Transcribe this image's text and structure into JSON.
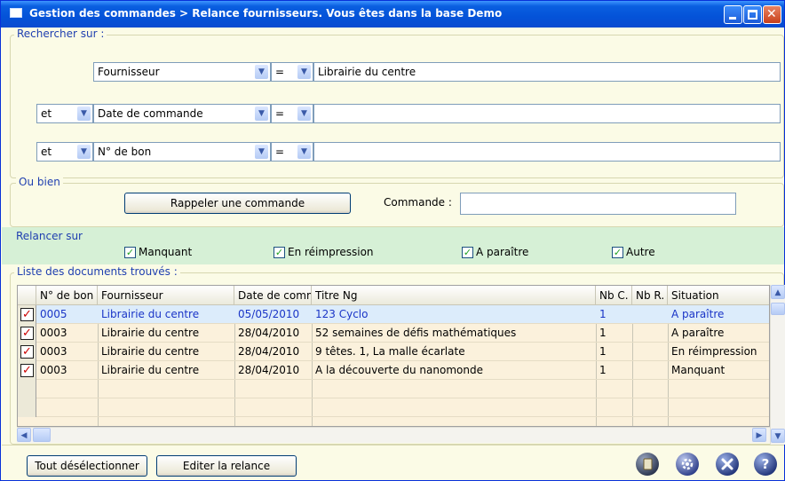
{
  "window": {
    "title": "Gestion des commandes > Relance fournisseurs.  Vous êtes dans la base Demo"
  },
  "search": {
    "legend": "Rechercher sur :",
    "rows": [
      {
        "conj": "",
        "field": "Fournisseur",
        "op": "=",
        "value": "Librairie du centre"
      },
      {
        "conj": "et",
        "field": "Date de commande",
        "op": "=",
        "value": ""
      },
      {
        "conj": "et",
        "field": "N° de bon",
        "op": "=",
        "value": ""
      }
    ]
  },
  "or_section": {
    "legend": "Ou bien",
    "recall_button": "Rappeler une commande",
    "order_label": "Commande :",
    "order_value": ""
  },
  "remind": {
    "legend": "Relancer sur",
    "options": [
      {
        "label": "Manquant",
        "checked": true
      },
      {
        "label": "En réimpression",
        "checked": true
      },
      {
        "label": "A paraître",
        "checked": true
      },
      {
        "label": "Autre",
        "checked": true
      }
    ]
  },
  "list": {
    "legend": "Liste des documents trouvés :",
    "columns": [
      "N° de bon",
      "Fournisseur",
      "Date de comm",
      "Titre Ng",
      "Nb C.",
      "Nb R.",
      "Situation"
    ],
    "rows": [
      {
        "checked": true,
        "selected": true,
        "cells": [
          "0005",
          "Librairie du centre",
          "05/05/2010",
          "123 Cyclo",
          "1",
          "",
          "A paraître"
        ]
      },
      {
        "checked": true,
        "selected": false,
        "cells": [
          "0003",
          "Librairie du centre",
          "28/04/2010",
          "52 semaines de défis mathématiques",
          "1",
          "",
          "A paraître"
        ]
      },
      {
        "checked": true,
        "selected": false,
        "cells": [
          "0003",
          "Librairie du centre",
          "28/04/2010",
          "9 têtes. 1, La malle écarlate",
          "1",
          "",
          "En réimpression"
        ]
      },
      {
        "checked": true,
        "selected": false,
        "cells": [
          "0003",
          "Librairie du centre",
          "28/04/2010",
          "A la découverte du nanomonde",
          "1",
          "",
          "Manquant"
        ]
      }
    ]
  },
  "footer": {
    "deselect_button": "Tout désélectionner",
    "edit_button": "Editer la relance"
  },
  "icons": {
    "note": "notebook-icon",
    "settings": "gear-icon",
    "close": "close-icon",
    "help": "help-icon"
  },
  "colors": {
    "title_bar": "#0a5fe0",
    "panel_bg": "#fbfbe6",
    "remind_bg": "#d6f0d6",
    "selected_row": "#dcecfb",
    "selected_text": "#1a35c7",
    "legend_text": "#1f3fb0"
  }
}
